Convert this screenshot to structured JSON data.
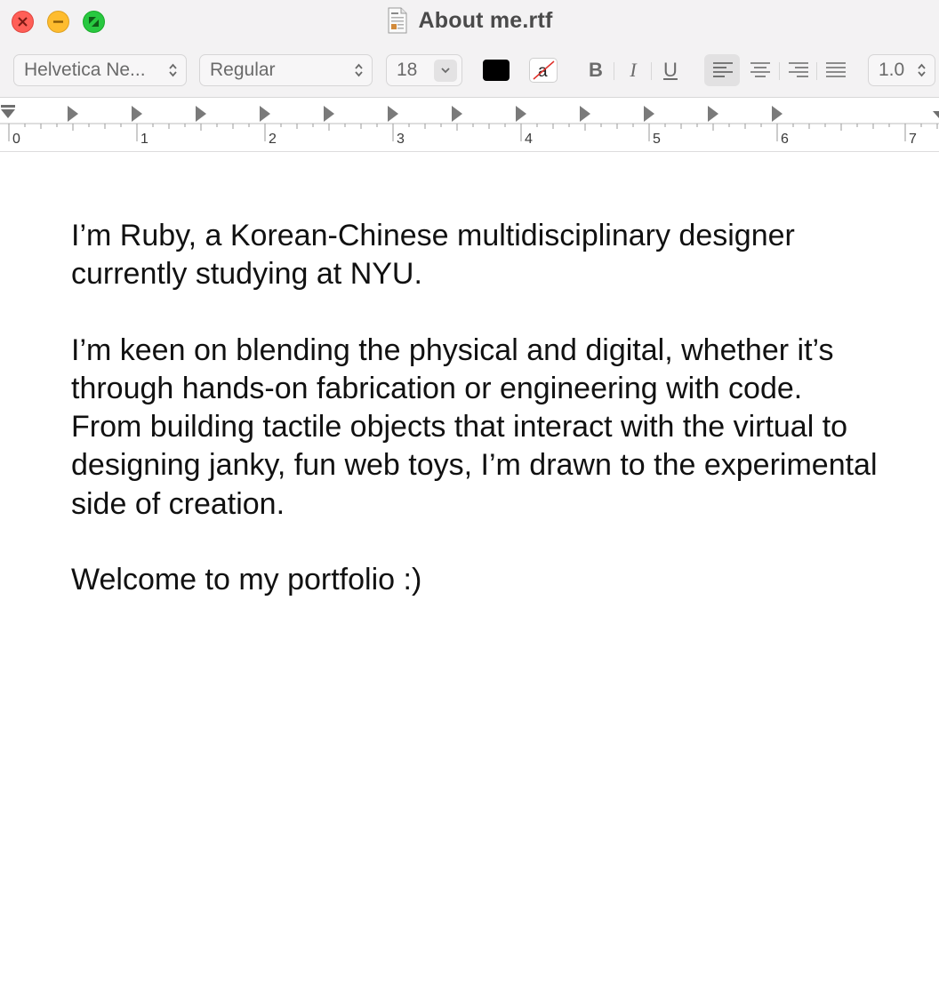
{
  "window": {
    "title": "About me.rtf"
  },
  "toolbar": {
    "font_family": "Helvetica Ne...",
    "font_style": "Regular",
    "font_size": "18",
    "text_color": "#000000",
    "background_color_letter": "a",
    "bold_label": "B",
    "italic_label": "I",
    "underline_label": "U",
    "alignment_active": "left",
    "line_spacing": "1.0"
  },
  "ruler": {
    "numbers": [
      "0",
      "1",
      "2",
      "3",
      "4",
      "5",
      "6",
      "7"
    ]
  },
  "document": {
    "paragraphs": [
      "I’m Ruby, a Korean-Chinese multidisciplinary designer currently studying at NYU.",
      "I’m keen on blending the physical and digital, whether it’s through hands-on fabrication or engineering with code. From building tactile objects that interact with the virtual to designing janky, fun web toys, I’m drawn to the experimental side of creation.",
      "Welcome to my portfolio :)"
    ]
  },
  "colors": {
    "close": "#ff5f57",
    "minimize": "#febc2e",
    "zoom": "#28c840",
    "toolbar_bg": "#f3f2f3"
  }
}
